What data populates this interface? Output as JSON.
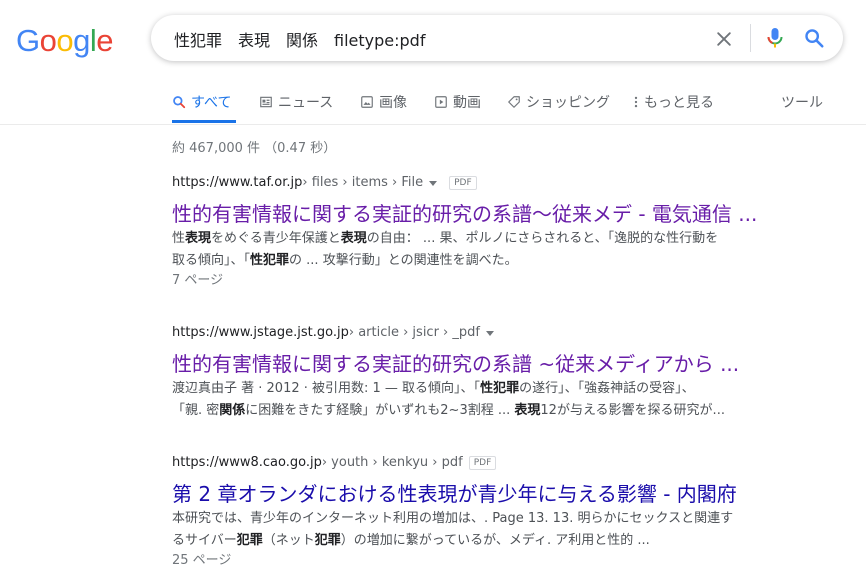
{
  "logo": {
    "text": "Google",
    "colors": [
      "#4285F4",
      "#EA4335",
      "#FBBC05",
      "#4285F4",
      "#34A853",
      "#EA4335"
    ]
  },
  "search": {
    "query": "性犯罪　表現　関係　filetype:pdf"
  },
  "tabs": [
    {
      "label": "すべて",
      "icon": "search-icon",
      "active": true
    },
    {
      "label": "ニュース",
      "icon": "news-icon"
    },
    {
      "label": "画像",
      "icon": "image-icon"
    },
    {
      "label": "動画",
      "icon": "video-icon"
    },
    {
      "label": "ショッピング",
      "icon": "tag-icon"
    },
    {
      "label": "もっと見る",
      "icon": "more-vert-icon"
    },
    {
      "label": "ツール"
    }
  ],
  "stats": "約 467,000 件 （0.47 秒）",
  "results": [
    {
      "domain": "https://www.taf.or.jp",
      "path": " › files › items › File",
      "badge": "PDF",
      "title": "性的有害情報に関する実証的研究の系譜～従来メデ - 電気通信 ...",
      "snippet1": [
        {
          "t": "性"
        },
        {
          "t": "表現",
          "b": true
        },
        {
          "t": "をめぐる青少年保護と"
        },
        {
          "t": "表現",
          "b": true
        },
        {
          "t": "の自由： ... 果、ポルノにさらされると、「逸脱的な性行動を"
        }
      ],
      "snippet2": [
        {
          "t": "取る傾向」、「"
        },
        {
          "t": "性犯罪",
          "b": true
        },
        {
          "t": "の ... 攻撃行動」との関連性を調べた。"
        }
      ],
      "pages": "7 ページ"
    },
    {
      "domain": "https://www.jstage.jst.go.jp",
      "path": " › article › jsicr › _pdf",
      "title": "性的有害情報に関する実証的研究の系譜 ~従来メディアから ...",
      "snippet1": [
        {
          "t": "渡辺真由子 著 · 2012 · 被引用数: 1 — 取る傾向」、「"
        },
        {
          "t": "性犯罪",
          "b": true
        },
        {
          "t": "の遂行」、「強姦神話の受容」、"
        }
      ],
      "snippet2": [
        {
          "t": "「親. 密"
        },
        {
          "t": "関係",
          "b": true
        },
        {
          "t": "に困難をきたす経験」がいずれも2~3割程 ... "
        },
        {
          "t": "表現",
          "b": true
        },
        {
          "t": "12が与える影響を探る研究が..."
        }
      ]
    },
    {
      "domain": "https://www8.cao.go.jp",
      "path": " › youth › kenkyu › pdf",
      "badge": "PDF",
      "title": "第 2 章オランダにおける性表現が青少年に与える影響 - 内閣府",
      "snippet1": [
        {
          "t": "本研究では、青少年のインターネット利用の増加は、. Page 13. 13. 明らかにセックスと関連す"
        }
      ],
      "snippet2": [
        {
          "t": "るサイバー"
        },
        {
          "t": "犯罪",
          "b": true
        },
        {
          "t": "（ネット"
        },
        {
          "t": "犯罪",
          "b": true
        },
        {
          "t": "）の増加に繋がっているが、メディ. ア利用と性的 ..."
        }
      ],
      "pages": "25 ページ"
    }
  ]
}
